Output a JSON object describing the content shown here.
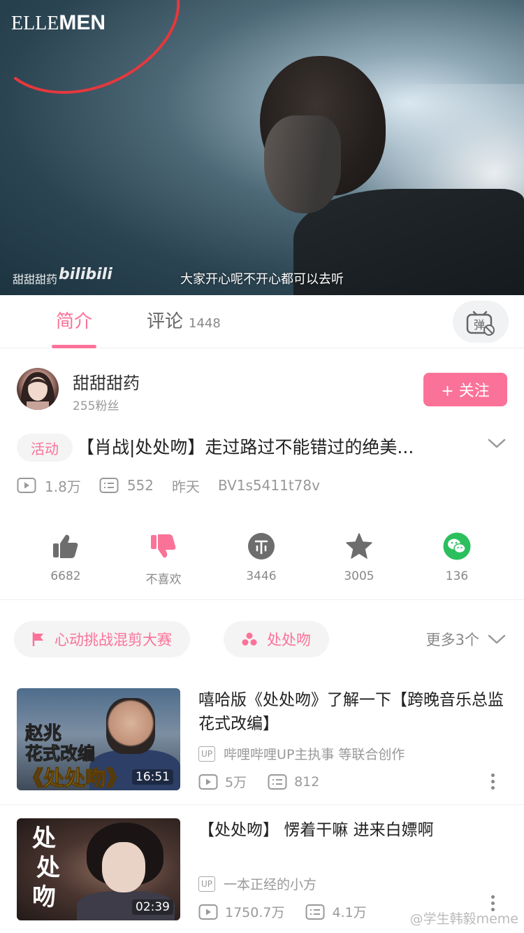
{
  "player": {
    "logo_part1": "ELLE",
    "logo_part2": "MEN",
    "uploader_mark": "甜甜甜药",
    "bilibili_mark": "bilibili",
    "subtitle": "大家开心呢不开心都可以去听"
  },
  "tabs": {
    "intro": "简介",
    "comments": "评论",
    "comments_count": "1448",
    "danmaku_char": "弹"
  },
  "uploader": {
    "name": "甜甜甜药",
    "fans": "255粉丝",
    "follow_label": "+ 关注"
  },
  "video": {
    "activity_tag": "活动",
    "title": "【肖战|处处吻】走过路过不能错过的绝美...",
    "views": "1.8万",
    "danmaku": "552",
    "date": "昨天",
    "bvid": "BV1s5411t78v"
  },
  "actions": {
    "like": "6682",
    "dislike": "不喜欢",
    "coin": "3446",
    "favorite": "3005",
    "share": "136"
  },
  "tags": {
    "tag1": "心动挑战混剪大赛",
    "tag2": "处处吻",
    "more": "更多3个"
  },
  "related": [
    {
      "title": "嘻哈版《处处吻》了解一下【跨晚音乐总监花式改编】",
      "up": "哔哩哔哩UP主执事  等联合创作",
      "views": "5万",
      "danmaku": "812",
      "duration": "16:51",
      "thumb_text1": "赵兆",
      "thumb_text2": "花式改编",
      "thumb_text3": "《处处吻》"
    },
    {
      "title": "【处处吻】 愣着干嘛  进来白嫖啊",
      "up": "一本正经的小方",
      "views": "1750.7万",
      "danmaku": "4.1万",
      "duration": "02:39",
      "thumb_text1": "处",
      "thumb_text2": "处",
      "thumb_text3": "吻"
    }
  ],
  "up_badge": "UP",
  "watermark": "@学生韩毅meme",
  "colors": {
    "accent": "#fb7299",
    "share_green": "#2bbf5d"
  }
}
